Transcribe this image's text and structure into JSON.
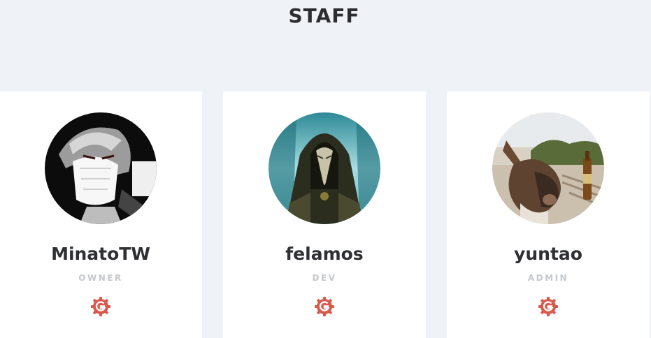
{
  "page": {
    "title": "STAFF"
  },
  "staff": [
    {
      "name": "MinatoTW",
      "role": "OWNER",
      "avatar": "anime-masked-character-avatar",
      "link_icon": "gitea-icon"
    },
    {
      "name": "felamos",
      "role": "DEV",
      "avatar": "plague-doctor-avatar",
      "link_icon": "gitea-icon"
    },
    {
      "name": "yuntao",
      "role": "ADMIN",
      "avatar": "donkey-with-bottle-avatar",
      "link_icon": "gitea-icon"
    }
  ],
  "colors": {
    "background": "#eff3f7",
    "card": "#ffffff",
    "name": "#2f3033",
    "role": "#c5c8cc",
    "gitea_icon": "#d9594c"
  }
}
